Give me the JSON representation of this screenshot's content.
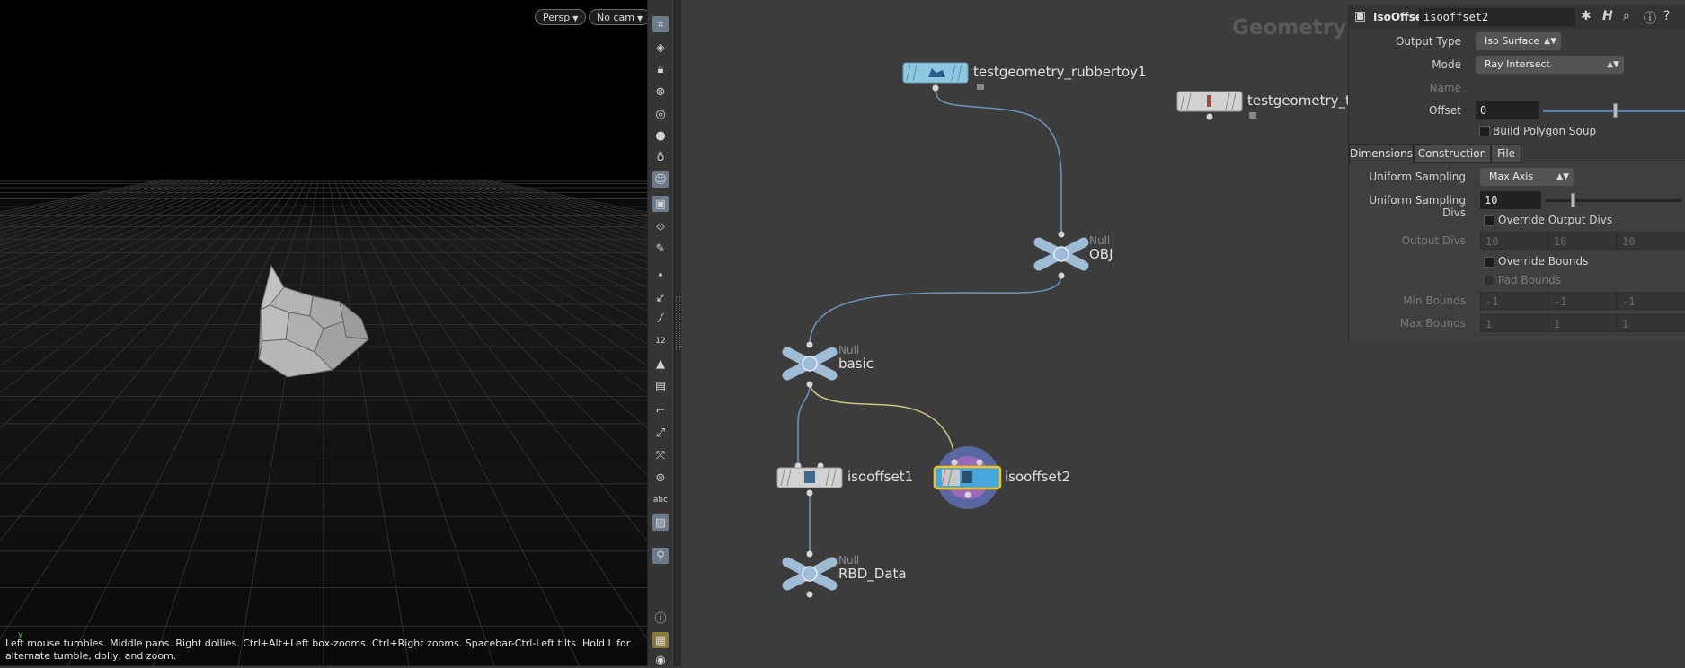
{
  "viewport": {
    "camera_persp": "Persp",
    "camera_cam": "No cam",
    "hint": "Left mouse tumbles. Middle pans. Right dollies. Ctrl+Alt+Left box-zooms. Ctrl+Right zooms. Spacebar-Ctrl-Left tilts. Hold L for alternate tumble, dolly, and zoom.",
    "axis_label": "y"
  },
  "toolbar": {
    "items": [
      "select-icon",
      "view-icon",
      "lock-icon",
      "snap-icon",
      "display-icon",
      "light-icon",
      "bulb-icon",
      "camera-icon",
      "render-icon",
      "handle-icon",
      "brush-icon",
      "point-icon",
      "edge-icon",
      "knife-icon",
      "number-icon",
      "paint-icon",
      "sculpt-icon",
      "curve-icon",
      "transform-icon",
      "bone-icon",
      "box-icon",
      "text-icon",
      "image-icon",
      "pin-icon",
      "info-icon",
      "layout-icon",
      "eye-icon"
    ],
    "text_tool": "abc",
    "number_tool": "12"
  },
  "network": {
    "context_label": "Geometry",
    "nodes": {
      "rubbertoy": {
        "name": "testgeometry_rubbertoy1"
      },
      "tommy": {
        "name": "testgeometry_tor"
      },
      "obj": {
        "type": "Null",
        "name": "OBJ"
      },
      "basic": {
        "type": "Null",
        "name": "basic"
      },
      "isooffset1": {
        "name": "isooffset1"
      },
      "isooffset2": {
        "name": "isooffset2"
      },
      "rbd": {
        "type": "Null",
        "name": "RBD_Data"
      }
    },
    "colors": {
      "wire": "#6e93bf",
      "selected_wire": "#c9c77e",
      "selected_outline": "#f0c419",
      "display_ring": "#7b73b8"
    }
  },
  "params": {
    "node_type": "IsoOffset",
    "node_name": "isooffset2",
    "output_type": {
      "label": "Output Type",
      "value": "Iso Surface"
    },
    "mode": {
      "label": "Mode",
      "value": "Ray Intersect"
    },
    "name": {
      "label": "Name"
    },
    "offset": {
      "label": "Offset",
      "value": "0",
      "slider_fraction": 0.5
    },
    "build_polygon_soup": {
      "label": "Build Polygon Soup"
    },
    "tabs": [
      "Dimensions",
      "Construction",
      "File"
    ],
    "uniform_sampling": {
      "label": "Uniform Sampling",
      "value": "Max Axis"
    },
    "uniform_sampling_divs": {
      "label": "Uniform Sampling Divs",
      "value": "10",
      "slider_fraction": 0.2
    },
    "override_output_divs": {
      "label": "Override Output Divs"
    },
    "output_divs": {
      "label": "Output Divs",
      "values": [
        "10",
        "10",
        "10"
      ]
    },
    "override_bounds": {
      "label": "Override Bounds"
    },
    "pad_bounds": {
      "label": "Pad Bounds"
    },
    "min_bounds": {
      "label": "Min Bounds",
      "values": [
        "-1",
        "-1",
        "-1"
      ]
    },
    "max_bounds": {
      "label": "Max Bounds",
      "values": [
        "1",
        "1",
        "1"
      ]
    }
  }
}
